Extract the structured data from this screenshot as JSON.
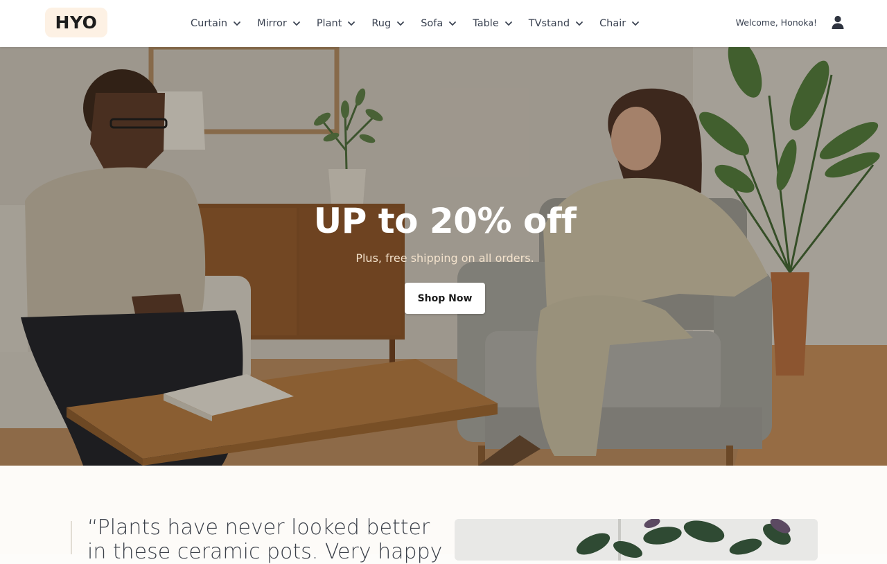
{
  "brand": {
    "logo": "HYO"
  },
  "nav": {
    "items": [
      {
        "label": "Curtain"
      },
      {
        "label": "Mirror"
      },
      {
        "label": "Plant"
      },
      {
        "label": "Rug"
      },
      {
        "label": "Sofa"
      },
      {
        "label": "Table"
      },
      {
        "label": "TVstand"
      },
      {
        "label": "Chair"
      }
    ]
  },
  "account": {
    "welcome": "Welcome, Honoka!",
    "icon": "user-icon"
  },
  "hero": {
    "title": "UP to 20% off",
    "subtitle": "Plus, free shipping on all orders.",
    "cta_label": "Shop Now"
  },
  "testimonial": {
    "quote": "“Plants have never looked better in these ceramic pots. Very happy"
  },
  "colors": {
    "header_bg": "#ffffff",
    "logo_bg": "#fdf1e4",
    "nav_text": "#3b4352",
    "cta_bg": "#ffffff",
    "subtitle_text": "#f4e3cd"
  }
}
